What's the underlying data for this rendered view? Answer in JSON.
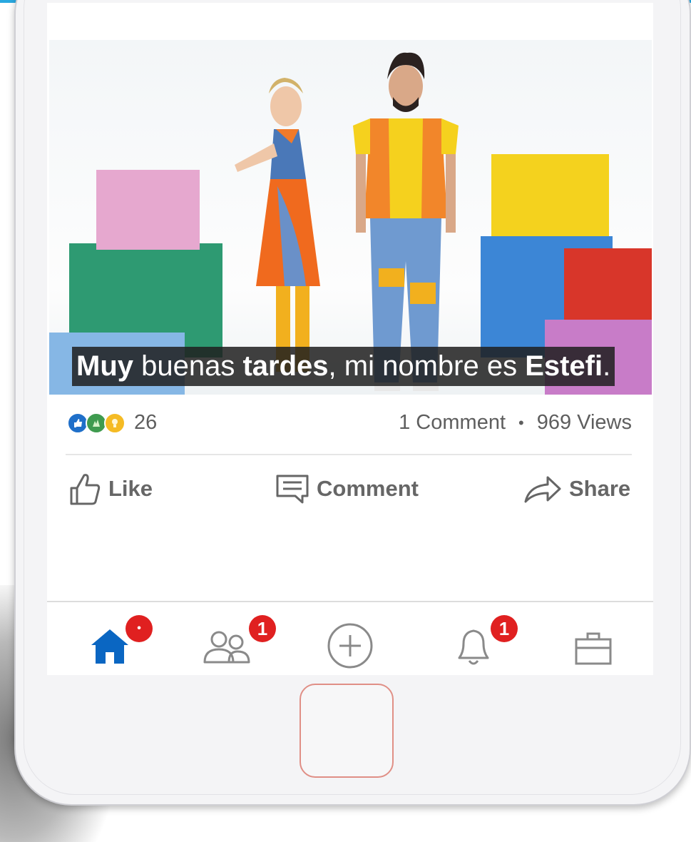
{
  "video": {
    "caption": {
      "w1": "Muy",
      "w2": " buenas ",
      "w3": "tardes",
      "w4": ", mi nombre es ",
      "w5": "Estefi",
      "w6": "."
    }
  },
  "stats": {
    "reaction_icons": [
      "like-icon",
      "celebrate-icon",
      "insightful-icon"
    ],
    "reaction_count": "26",
    "comments": "1 Comment",
    "separator": "•",
    "views": "969 Views"
  },
  "actions": {
    "like_label": "Like",
    "comment_label": "Comment",
    "share_label": "Share"
  },
  "nav": {
    "items": [
      {
        "icon": "home-icon",
        "badge": "•"
      },
      {
        "icon": "my-network-icon",
        "badge": "1"
      },
      {
        "icon": "post-icon",
        "badge": ""
      },
      {
        "icon": "notifications-icon",
        "badge": "1"
      },
      {
        "icon": "jobs-icon",
        "badge": ""
      }
    ]
  },
  "colors": {
    "accent": "#0a66c2",
    "badge": "#e02020",
    "text_muted": "#5e5e5e"
  }
}
